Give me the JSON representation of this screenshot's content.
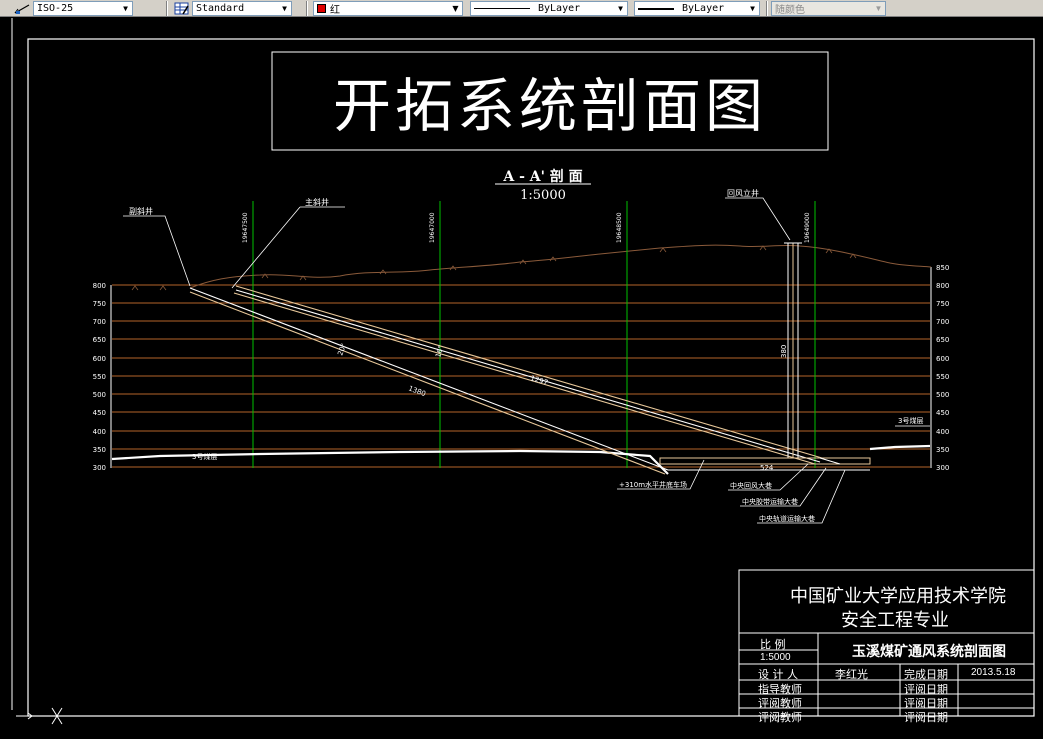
{
  "toolbar": {
    "dimstyle": "ISO-25",
    "tablestyle": "Standard",
    "color_label": "红",
    "color_swatch": "#e00000",
    "linetype": "ByLayer",
    "lineweight": "ByLayer",
    "plotstyle": "随颜色"
  },
  "drawing": {
    "main_title": "开拓系统剖面图",
    "section_title": "A - A' 剖 面",
    "scale": "1:5000",
    "coords": [
      "19647500",
      "19647000",
      "19648500",
      "19649000"
    ],
    "elev_left": [
      "800",
      "750",
      "700",
      "650",
      "600",
      "550",
      "500",
      "450",
      "400",
      "350",
      "300"
    ],
    "elev_right": [
      "850",
      "800",
      "750",
      "700",
      "650",
      "600",
      "550",
      "500",
      "450",
      "400",
      "350",
      "300"
    ],
    "labels": {
      "aux_incline": "副斜井",
      "main_incline": "主斜井",
      "return_shaft": "回风立井",
      "seam3_left": "3号煤层",
      "seam3_right": "3号煤层",
      "level_310": "+310m水平井底车场",
      "central_return": "中央回风大巷",
      "central_belt": "中央胶带运输大巷",
      "central_track": "中央轨道运输大巷",
      "len_aux": "1380",
      "len_main": "1297",
      "dim_aux": "20°",
      "dim_main": "16°",
      "shaft_depth": "380",
      "bottom_dim": "524"
    }
  },
  "title_block": {
    "school": "中国矿业大学应用技术学院",
    "major": "安全工程专业",
    "scale_label": "比    例",
    "scale_value": "1:5000",
    "project": "玉溪煤矿通风系统剖面图",
    "designer_label": "设 计 人",
    "designer": "李红光",
    "finish_label": "完成日期",
    "finish_date": "2013.5.18",
    "advisor_label": "指导教师",
    "reviewer1_label": "评阅教师",
    "reviewer2_label": "评阅教师",
    "review_date_label1": "评阅日期",
    "review_date_label2": "评阅日期",
    "review_date_label3": "评阅日期"
  },
  "colors": {
    "background": "#000000",
    "grid_line": "#b5652a",
    "coord_line": "#00c000",
    "frame": "#ffffff",
    "terrain": "#8a5a3a",
    "shaft": "#e8c89a"
  }
}
